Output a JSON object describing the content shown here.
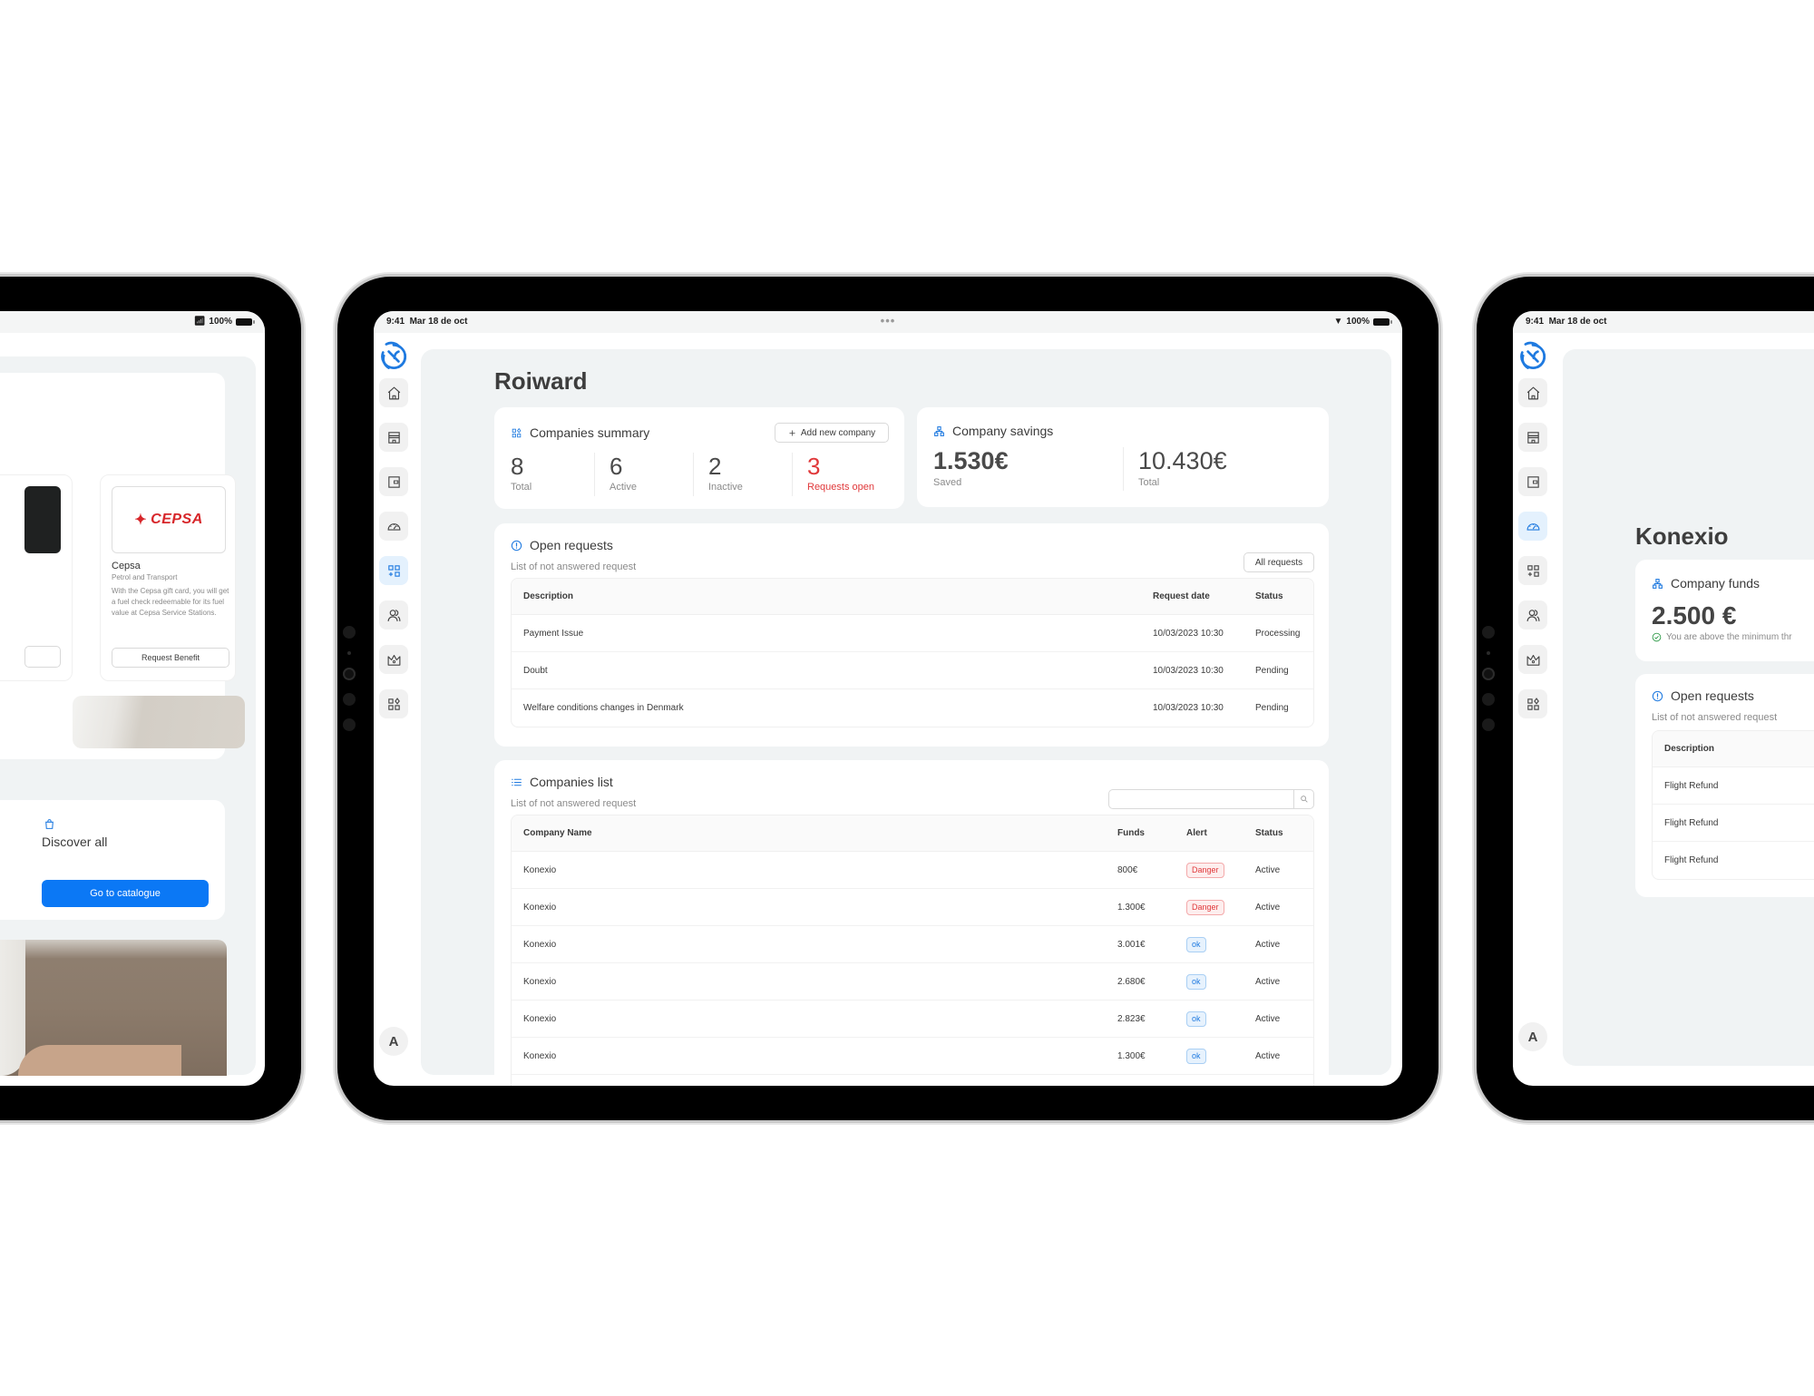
{
  "status_bar": {
    "time": "9:41",
    "date": "Mar 18 de oct",
    "battery": "100%",
    "multitask_dots": "•••"
  },
  "sidebar": {
    "items": [
      {
        "icon": "home-icon",
        "label": "Home"
      },
      {
        "icon": "store-icon",
        "label": "Store"
      },
      {
        "icon": "wallet-icon",
        "label": "Wallet"
      },
      {
        "icon": "dashboard-gauge-icon",
        "label": "Dashboard"
      },
      {
        "icon": "companies-grid-add-icon",
        "label": "Companies"
      },
      {
        "icon": "users-icon",
        "label": "Users"
      },
      {
        "icon": "crown-icon",
        "label": "Premium"
      },
      {
        "icon": "apps-grid-icon",
        "label": "Apps"
      }
    ],
    "avatar_initial": "A"
  },
  "left_device": {
    "benefit": {
      "brand_logo_text": "CEPSA",
      "name": "Cepsa",
      "category": "Petrol and Transport",
      "description": "With the Cepsa gift card, you will get a fuel check redeemable for its fuel value at Cepsa Service Stations.",
      "button": "Request Benefit"
    },
    "discover": {
      "icon": "shopping-bag-icon",
      "title": "Discover all",
      "button": "Go to catalogue"
    }
  },
  "main_device": {
    "active_nav": "companies",
    "page_title": "Roiward",
    "companies_summary": {
      "title": "Companies summary",
      "add_button": "Add new company",
      "stats": [
        {
          "value": "8",
          "label": "Total"
        },
        {
          "value": "6",
          "label": "Active"
        },
        {
          "value": "2",
          "label": "Inactive"
        },
        {
          "value": "3",
          "label": "Requests open",
          "highlight": true
        }
      ]
    },
    "company_savings": {
      "title": "Company savings",
      "saved_value": "1.530€",
      "saved_label": "Saved",
      "total_value": "10.430€",
      "total_label": "Total"
    },
    "open_requests": {
      "title": "Open requests",
      "subtitle": "List of not answered request",
      "all_button": "All requests",
      "columns": [
        "Description",
        "Request date",
        "Status"
      ],
      "rows": [
        {
          "description": "Payment Issue",
          "date": "10/03/2023 10:30",
          "status": "Processing"
        },
        {
          "description": "Doubt",
          "date": "10/03/2023 10:30",
          "status": "Pending"
        },
        {
          "description": "Welfare conditions changes in Denmark",
          "date": "10/03/2023 10:30",
          "status": "Pending"
        }
      ]
    },
    "companies_list": {
      "title": "Companies list",
      "subtitle": "List of not answered request",
      "search_placeholder": "",
      "columns": [
        "Company Name",
        "Funds",
        "Alert",
        "Status"
      ],
      "rows": [
        {
          "name": "Konexio",
          "funds": "800€",
          "alert": "Danger",
          "alert_type": "danger",
          "status": "Active"
        },
        {
          "name": "Konexio",
          "funds": "1.300€",
          "alert": "Danger",
          "alert_type": "danger",
          "status": "Active"
        },
        {
          "name": "Konexio",
          "funds": "3.001€",
          "alert": "ok",
          "alert_type": "ok",
          "status": "Active"
        },
        {
          "name": "Konexio",
          "funds": "2.680€",
          "alert": "ok",
          "alert_type": "ok",
          "status": "Active"
        },
        {
          "name": "Konexio",
          "funds": "2.823€",
          "alert": "ok",
          "alert_type": "ok",
          "status": "Active"
        },
        {
          "name": "Konexio",
          "funds": "1.300€",
          "alert": "ok",
          "alert_type": "ok",
          "status": "Active"
        }
      ]
    }
  },
  "right_device": {
    "active_nav": "dashboard",
    "page_title": "Konexio",
    "company_funds": {
      "title": "Company funds",
      "value": "2.500 €",
      "note": "You are above the minimum thr"
    },
    "open_requests": {
      "title": "Open requests",
      "subtitle": "List of not answered request",
      "columns": [
        "Description"
      ],
      "rows": [
        "Flight Refund",
        "Flight Refund",
        "Flight Refund"
      ]
    }
  },
  "colors": {
    "accent_blue": "#1f7ae0",
    "primary_button": "#0b78f5",
    "danger_red": "#e0383a",
    "success_green": "#2e9a48",
    "content_background": "#f0f3f4"
  }
}
